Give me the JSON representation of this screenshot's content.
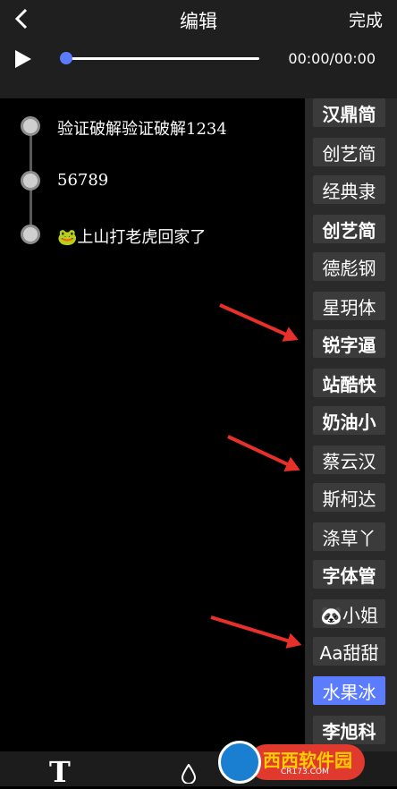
{
  "header": {
    "title": "编辑",
    "done_label": "完成"
  },
  "player": {
    "time": "00:00/00:00",
    "progress": 0
  },
  "lyrics": {
    "lines": [
      {
        "text": "验证破解验证破解1234"
      },
      {
        "text": "56789"
      },
      {
        "text": "🐸上山打老虎回家了"
      }
    ]
  },
  "fonts": {
    "items": [
      {
        "label": "汉鼎简",
        "state": "selected"
      },
      {
        "label": "创艺简",
        "state": "normal"
      },
      {
        "label": "经典隶",
        "state": "normal"
      },
      {
        "label": "创艺简",
        "state": "normal"
      },
      {
        "label": "德彪钢",
        "state": "normal"
      },
      {
        "label": "星玥体",
        "state": "normal"
      },
      {
        "label": "锐字逼",
        "state": "normal"
      },
      {
        "label": "站酷快",
        "state": "normal"
      },
      {
        "label": "奶油小",
        "state": "normal"
      },
      {
        "label": "蔡云汉",
        "state": "normal"
      },
      {
        "label": "斯柯达",
        "state": "normal"
      },
      {
        "label": "涤草丫",
        "state": "normal"
      },
      {
        "label": "字体管",
        "state": "normal"
      },
      {
        "label": "🐼小姐",
        "state": "normal"
      },
      {
        "label": "Aa甜甜",
        "state": "normal"
      },
      {
        "label": "水果冰",
        "state": "active"
      },
      {
        "label": "李旭科",
        "state": "normal"
      }
    ]
  },
  "toolbar": {
    "text_tool": "T"
  },
  "watermark": {
    "brand": "西西软件园",
    "domain": "CR173.COM"
  },
  "colors": {
    "accent": "#5b7cff",
    "arrow": "#e8302a"
  }
}
